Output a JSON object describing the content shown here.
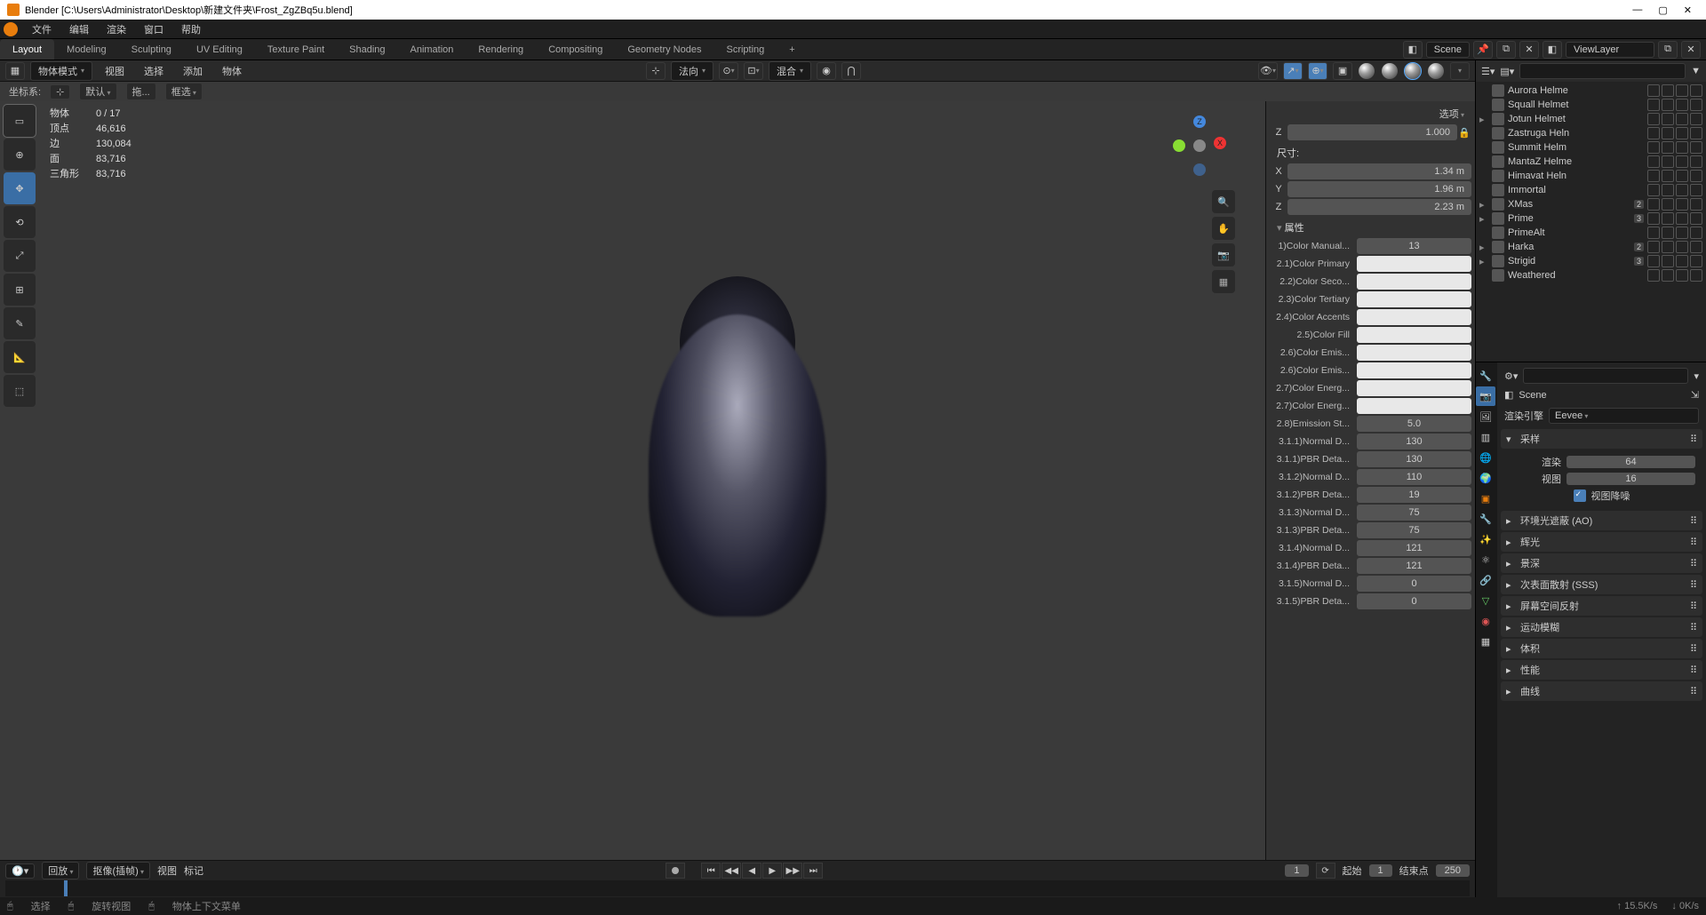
{
  "title": "Blender [C:\\Users\\Administrator\\Desktop\\新建文件夹\\Frost_ZgZBq5u.blend]",
  "top_menu": [
    "文件",
    "编辑",
    "渲染",
    "窗口",
    "帮助"
  ],
  "workspace_tabs": [
    "Layout",
    "Modeling",
    "Sculpting",
    "UV Editing",
    "Texture Paint",
    "Shading",
    "Animation",
    "Rendering",
    "Compositing",
    "Geometry Nodes",
    "Scripting"
  ],
  "scene_field": "Scene",
  "viewlayer_field": "ViewLayer",
  "viewport": {
    "mode": "物体模式",
    "header_menus": [
      "视图",
      "选择",
      "添加",
      "物体"
    ],
    "orient_method": "法向",
    "shading_combo": "混合",
    "coord_label": "坐标系:",
    "coord_default": "默认",
    "drag": "拖...",
    "box_select": "框选",
    "options": "选项",
    "stats": {
      "objects_l": "物体",
      "objects_v": "0 / 17",
      "verts_l": "顶点",
      "verts_v": "46,616",
      "edges_l": "边",
      "edges_v": "130,084",
      "faces_l": "面",
      "faces_v": "83,716",
      "tris_l": "三角形",
      "tris_v": "83,716"
    }
  },
  "npanel": {
    "transform_z_label": "Z",
    "transform_z_val": "1.000",
    "dim_label": "尺寸:",
    "dim_x": "1.34 m",
    "dim_y": "1.96 m",
    "dim_z": "2.23 m",
    "attr_header": "属性",
    "rows": [
      {
        "l": "1)Color Manual...",
        "v": "13"
      },
      {
        "l": "2.1)Color Primary",
        "swatch": 1
      },
      {
        "l": "2.2)Color Seco...",
        "swatch": 1
      },
      {
        "l": "2.3)Color Tertiary",
        "swatch": 1
      },
      {
        "l": "2.4)Color Accents",
        "swatch": 1
      },
      {
        "l": "2.5)Color Fill",
        "swatch": 1
      },
      {
        "l": "2.6)Color Emis...",
        "swatch": 1
      },
      {
        "l": "2.6)Color Emis...",
        "swatch": 1
      },
      {
        "l": "2.7)Color Energ...",
        "swatch": 1
      },
      {
        "l": "2.7)Color Energ...",
        "swatch": 1
      },
      {
        "l": "2.8)Emission St...",
        "v": "5.0"
      },
      {
        "l": "3.1.1)Normal D...",
        "v": "130"
      },
      {
        "l": "3.1.1)PBR Deta...",
        "v": "130"
      },
      {
        "l": "3.1.2)Normal D...",
        "v": "110"
      },
      {
        "l": "3.1.2)PBR Deta...",
        "v": "19"
      },
      {
        "l": "3.1.3)Normal D...",
        "v": "75"
      },
      {
        "l": "3.1.3)PBR Deta...",
        "v": "75"
      },
      {
        "l": "3.1.4)Normal D...",
        "v": "121"
      },
      {
        "l": "3.1.4)PBR Deta...",
        "v": "121"
      },
      {
        "l": "3.1.5)Normal D...",
        "v": "0"
      },
      {
        "l": "3.1.5)PBR Deta...",
        "v": "0"
      }
    ]
  },
  "timeline": {
    "playback": "回放",
    "keying": "抠像(插帧)",
    "view": "视图",
    "marker": "标记",
    "cur": "1",
    "start_l": "起始",
    "start_v": "1",
    "end_l": "结束点",
    "end_v": "250"
  },
  "outliner": {
    "items": [
      {
        "n": "Aurora Helme"
      },
      {
        "n": "Squall Helmet"
      },
      {
        "n": "Jotun Helmet",
        "t": 1
      },
      {
        "n": "Zastruga Heln"
      },
      {
        "n": "Summit Helm"
      },
      {
        "n": "MantaZ Helme"
      },
      {
        "n": "Himavat Heln"
      },
      {
        "n": "Immortal"
      },
      {
        "n": "XMas",
        "b": "2",
        "t": 1
      },
      {
        "n": "Prime",
        "b": "3",
        "t": 1
      },
      {
        "n": "PrimeAlt"
      },
      {
        "n": "Harka",
        "b": "2",
        "t": 1
      },
      {
        "n": "Strigid",
        "b": "3",
        "t": 1
      },
      {
        "n": "Weathered"
      }
    ]
  },
  "props": {
    "scene_crumb": "Scene",
    "engine_label": "渲染引擎",
    "engine_value": "Eevee",
    "sampling_header": "采样",
    "render_l": "渲染",
    "render_v": "64",
    "viewport_l": "视图",
    "viewport_v": "16",
    "denoise": "视图降噪",
    "panels": [
      "环境光遮蔽 (AO)",
      "辉光",
      "景深",
      "次表面散射 (SSS)",
      "屏幕空间反射",
      "运动模糊",
      "体积",
      "性能",
      "曲线"
    ]
  },
  "status": {
    "select": "选择",
    "rotate": "旋转视图",
    "context": "物体上下文菜单",
    "mem": "15.5K/s",
    "net": "0K/s"
  }
}
